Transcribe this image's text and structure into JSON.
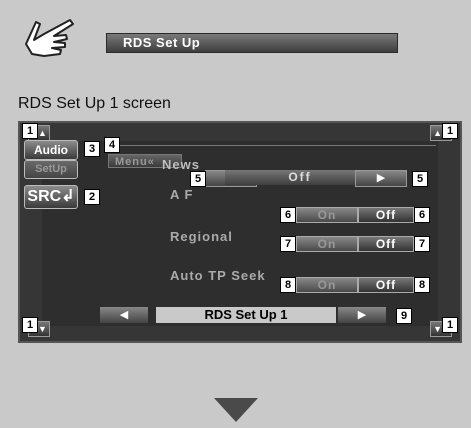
{
  "header": {
    "title": "RDS Set Up"
  },
  "caption": "RDS Set Up 1 screen",
  "screen": {
    "side": {
      "audio": "Audio",
      "setup": "SetUp",
      "src": "SRC"
    },
    "menu": "Menu",
    "rows": {
      "news": {
        "label": "News",
        "value": "Off"
      },
      "af": {
        "label": "A F",
        "on": "On",
        "off": "Off"
      },
      "regional": {
        "label": "Regional",
        "on": "On",
        "off": "Off"
      },
      "autotp": {
        "label": "Auto TP Seek",
        "on": "On",
        "off": "Off"
      }
    },
    "bottom_title": "RDS Set Up 1"
  },
  "callouts": {
    "n1": "1",
    "n2": "2",
    "n3": "3",
    "n4": "4",
    "n5": "5",
    "n6": "6",
    "n7": "7",
    "n8": "8",
    "n9": "9"
  }
}
